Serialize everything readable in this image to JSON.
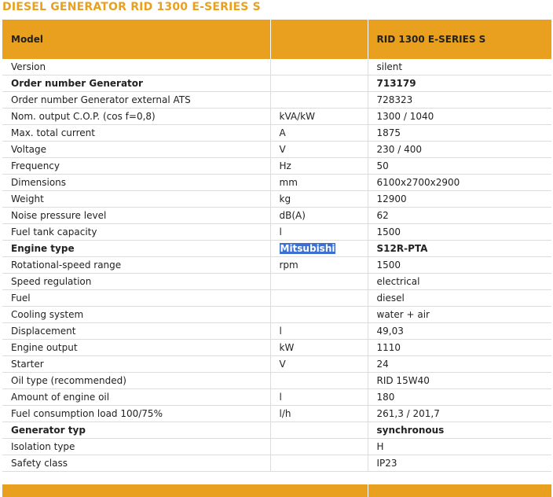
{
  "title": "DIESEL GENERATOR RID 1300 E-SERIES S",
  "header": {
    "col1": "Model",
    "col2": "",
    "col3": "RID 1300 E-SERIES S"
  },
  "rows": [
    {
      "label": "Version",
      "unit": "",
      "value": "silent",
      "bold": false
    },
    {
      "label": "Order number Generator",
      "unit": "",
      "value": "713179",
      "bold": true
    },
    {
      "label": "Order number Generator external ATS",
      "unit": "",
      "value": "728323",
      "bold": false
    },
    {
      "label": "Nom. output C.O.P. (cos f=0,8)",
      "unit": "kVA/kW",
      "value": "1300 / 1040",
      "bold": false
    },
    {
      "label": "Max. total current",
      "unit": "A",
      "value": "1875",
      "bold": false
    },
    {
      "label": "Voltage",
      "unit": "V",
      "value": "230 / 400",
      "bold": false
    },
    {
      "label": "Frequency",
      "unit": "Hz",
      "value": "50",
      "bold": false
    },
    {
      "label": "Dimensions",
      "unit": "mm",
      "value": "6100x2700x2900",
      "bold": false
    },
    {
      "label": "Weight",
      "unit": "kg",
      "value": "12900",
      "bold": false
    },
    {
      "label": "Noise pressure level",
      "unit": "dB(A)",
      "value": "62",
      "bold": false
    },
    {
      "label": "Fuel tank capacity",
      "unit": "l",
      "value": "1500",
      "bold": false
    },
    {
      "label": "Engine type",
      "unit": "Mitsubishi",
      "value": "S12R-PTA",
      "bold": true,
      "unit_highlight": true
    },
    {
      "label": "Rotational-speed range",
      "unit": "rpm",
      "value": "1500",
      "bold": false
    },
    {
      "label": "Speed regulation",
      "unit": "",
      "value": "electrical",
      "bold": false
    },
    {
      "label": "Fuel",
      "unit": "",
      "value": "diesel",
      "bold": false
    },
    {
      "label": "Cooling system",
      "unit": "",
      "value": "water + air",
      "bold": false
    },
    {
      "label": "Displacement",
      "unit": "l",
      "value": "49,03",
      "bold": false
    },
    {
      "label": "Engine output",
      "unit": "kW",
      "value": "1110",
      "bold": false
    },
    {
      "label": "Starter",
      "unit": "V",
      "value": "24",
      "bold": false
    },
    {
      "label": "Oil type (recommended)",
      "unit": "",
      "value": "RID 15W40",
      "bold": false
    },
    {
      "label": "Amount of engine oil",
      "unit": "l",
      "value": "180",
      "bold": false
    },
    {
      "label": "Fuel consumption load 100/75%",
      "unit": "l/h",
      "value": "261,3 / 201,7",
      "bold": false
    },
    {
      "label": "Generator typ",
      "unit": "",
      "value": "synchronous",
      "bold": true
    },
    {
      "label": "Isolation type",
      "unit": "",
      "value": "H",
      "bold": false
    },
    {
      "label": "Safety class",
      "unit": "",
      "value": "IP23",
      "bold": false
    }
  ],
  "colors": {
    "accent": "#E8A01E",
    "selection": "#3C6FD0"
  }
}
